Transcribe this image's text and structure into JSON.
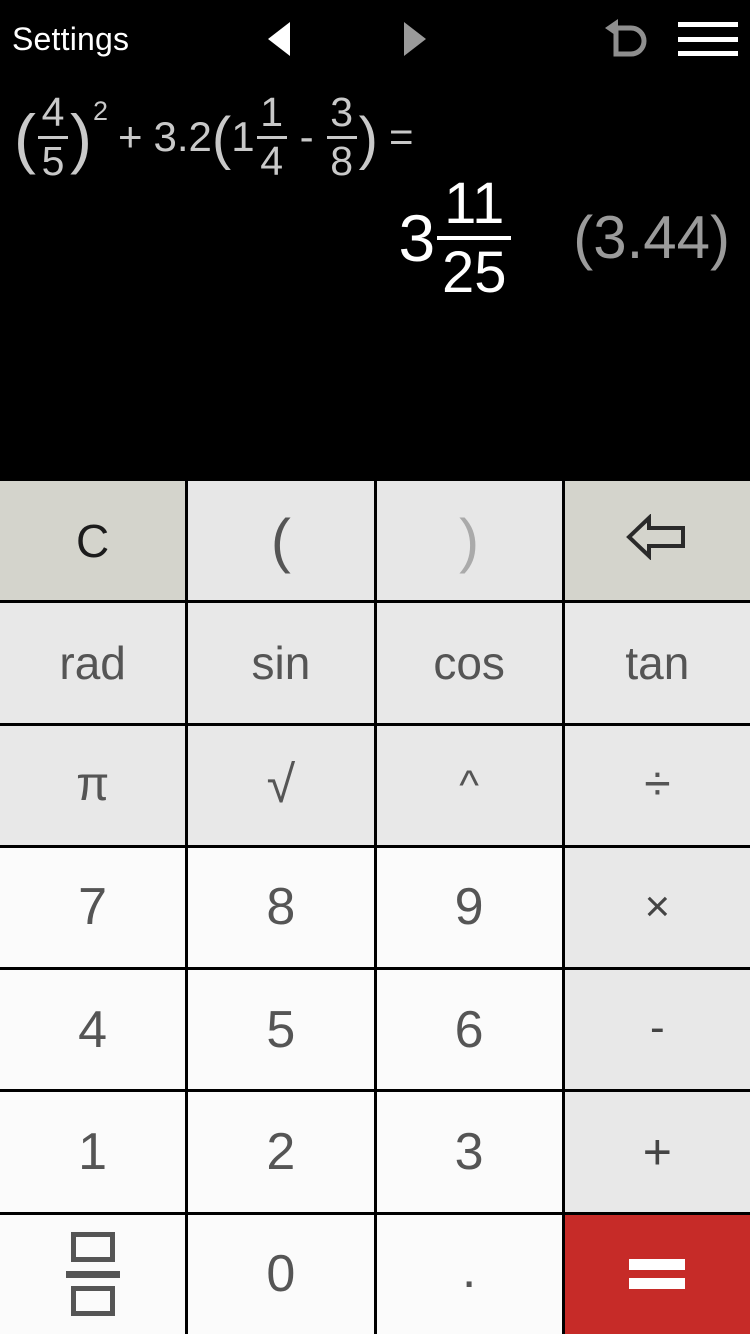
{
  "topbar": {
    "settings_label": "Settings",
    "prev_icon": "triangle-left-icon",
    "next_icon": "triangle-right-icon",
    "undo_icon": "undo-arrow-icon",
    "menu_icon": "hamburger-menu-icon",
    "accent_white": "#ffffff",
    "accent_dim": "#9a9a9a"
  },
  "display": {
    "expression": {
      "full_text": "(4/5)^2 + 3.2(1 1/4 - 3/8) =",
      "open_paren": "(",
      "frac1": {
        "num": "4",
        "den": "5"
      },
      "close_paren": ")",
      "exponent": "2",
      "plus": "+",
      "coefficient": "3.2",
      "open_paren2": "(",
      "mixed_whole": "1",
      "frac2": {
        "num": "1",
        "den": "4"
      },
      "minus": "-",
      "frac3": {
        "num": "3",
        "den": "8"
      },
      "close_paren2": ")",
      "equals": "=",
      "color": "#c9c9c9"
    },
    "result": {
      "whole": "3",
      "frac": {
        "num": "11",
        "den": "25"
      },
      "decimal": "(3.44)",
      "exact_color": "#ffffff",
      "decimal_color": "#9b9b9b"
    },
    "background": "#000000"
  },
  "keypad": {
    "rows": [
      {
        "keys": [
          {
            "label": "C",
            "name": "clear-key",
            "style": "beige",
            "type": "text"
          },
          {
            "label": "(",
            "name": "open-paren-key",
            "style": "lighter",
            "type": "paren"
          },
          {
            "label": ")",
            "name": "close-paren-key",
            "style": "lighter",
            "type": "paren",
            "disabled": true
          },
          {
            "label": "",
            "name": "backspace-key",
            "style": "beige",
            "type": "backspace-icon"
          }
        ]
      },
      {
        "keys": [
          {
            "label": "rad",
            "name": "rad-key",
            "style": "light",
            "type": "word"
          },
          {
            "label": "sin",
            "name": "sin-key",
            "style": "light",
            "type": "word"
          },
          {
            "label": "cos",
            "name": "cos-key",
            "style": "light",
            "type": "word"
          },
          {
            "label": "tan",
            "name": "tan-key",
            "style": "light",
            "type": "word"
          }
        ]
      },
      {
        "keys": [
          {
            "label": "π",
            "name": "pi-key",
            "style": "light",
            "type": "pi"
          },
          {
            "label": "√",
            "name": "sqrt-key",
            "style": "light",
            "type": "sqrt"
          },
          {
            "label": "^",
            "name": "power-key",
            "style": "light",
            "type": "caret"
          },
          {
            "label": "÷",
            "name": "divide-key",
            "style": "light",
            "type": "sym"
          }
        ]
      },
      {
        "keys": [
          {
            "label": "7",
            "name": "digit-7-key",
            "style": "num",
            "type": "digit"
          },
          {
            "label": "8",
            "name": "digit-8-key",
            "style": "num",
            "type": "digit"
          },
          {
            "label": "9",
            "name": "digit-9-key",
            "style": "num",
            "type": "digit"
          },
          {
            "label": "×",
            "name": "multiply-key",
            "style": "op",
            "type": "mul"
          }
        ]
      },
      {
        "keys": [
          {
            "label": "4",
            "name": "digit-4-key",
            "style": "num",
            "type": "digit"
          },
          {
            "label": "5",
            "name": "digit-5-key",
            "style": "num",
            "type": "digit"
          },
          {
            "label": "6",
            "name": "digit-6-key",
            "style": "num",
            "type": "digit"
          },
          {
            "label": "-",
            "name": "subtract-key",
            "style": "op",
            "type": "minus"
          }
        ]
      },
      {
        "keys": [
          {
            "label": "1",
            "name": "digit-1-key",
            "style": "num",
            "type": "digit"
          },
          {
            "label": "2",
            "name": "digit-2-key",
            "style": "num",
            "type": "digit"
          },
          {
            "label": "3",
            "name": "digit-3-key",
            "style": "num",
            "type": "digit"
          },
          {
            "label": "+",
            "name": "add-key",
            "style": "op",
            "type": "plus"
          }
        ]
      },
      {
        "keys": [
          {
            "label": "",
            "name": "fraction-key",
            "style": "num",
            "type": "fraction-icon"
          },
          {
            "label": "0",
            "name": "digit-0-key",
            "style": "num",
            "type": "digit"
          },
          {
            "label": ".",
            "name": "decimal-point-key",
            "style": "num",
            "type": "dot"
          },
          {
            "label": "=",
            "name": "equals-key",
            "style": "equals",
            "type": "equals-icon"
          }
        ]
      }
    ],
    "colors": {
      "beige": "#d4d4cc",
      "light": "#e8e8e8",
      "number": "#fbfbfb",
      "equals_red": "#c62b28",
      "divider": "#000000",
      "text": "#555555"
    }
  }
}
